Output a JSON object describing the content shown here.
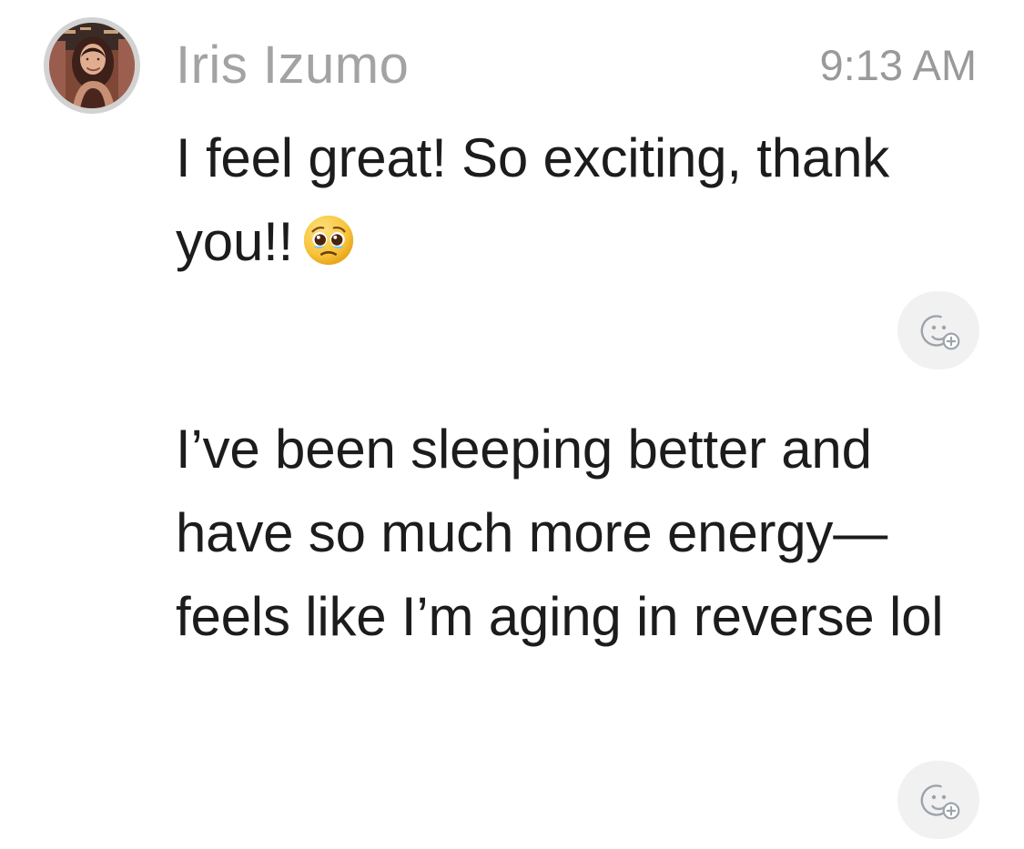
{
  "message": {
    "sender": {
      "name": "Iris Izumo",
      "avatar_icon": "profile-photo-avatar"
    },
    "time": "9:13 AM",
    "items": [
      {
        "text": "I feel great! So exciting, thank you!!",
        "emoji": "pleading-face-emoji",
        "reaction_icon": "add-reaction-icon"
      },
      {
        "text": "I’ve been sleeping better and have so much more energy—feels like I’m aging in reverse lol",
        "reaction_icon": "add-reaction-icon"
      }
    ]
  },
  "colors": {
    "name": "#A3A3A3",
    "timestamp": "#9A9A9A",
    "message_text": "#1C1C1C",
    "reaction_button": "#F1F1F1",
    "reaction_icon": "#9DA3AA"
  }
}
